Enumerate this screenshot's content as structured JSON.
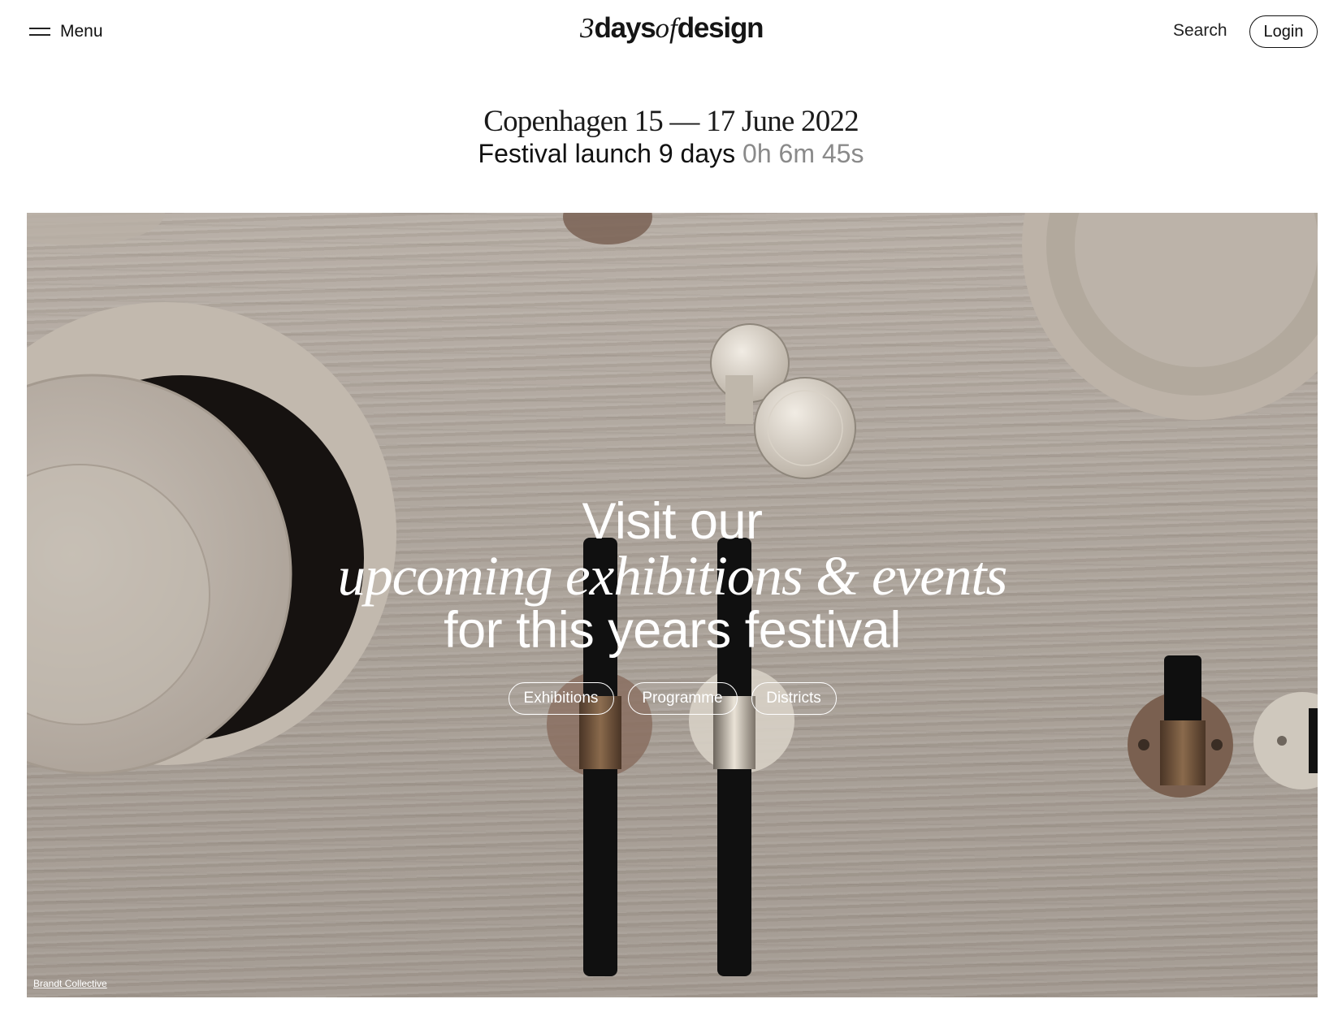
{
  "header": {
    "menu_label": "Menu",
    "logo": {
      "number": "3",
      "part1": "days",
      "part2": "of",
      "part3": "design"
    },
    "search_label": "Search",
    "login_label": "Login"
  },
  "intro": {
    "dates": "Copenhagen 15 — 17 June 2022",
    "countdown_prefix": "Festival launch 9 days",
    "countdown_time": "0h 6m 45s"
  },
  "hero": {
    "line1": "Visit our",
    "line2": "upcoming exhibitions & events",
    "line3": "for this years festival",
    "buttons": [
      "Exhibitions",
      "Programme",
      "Districts"
    ],
    "photo_credit": "Brandt Collective"
  },
  "colors": {
    "text": "#111111",
    "muted": "#8a8a8a",
    "hero_stone": "#aba299",
    "hero_text": "#ffffff"
  }
}
